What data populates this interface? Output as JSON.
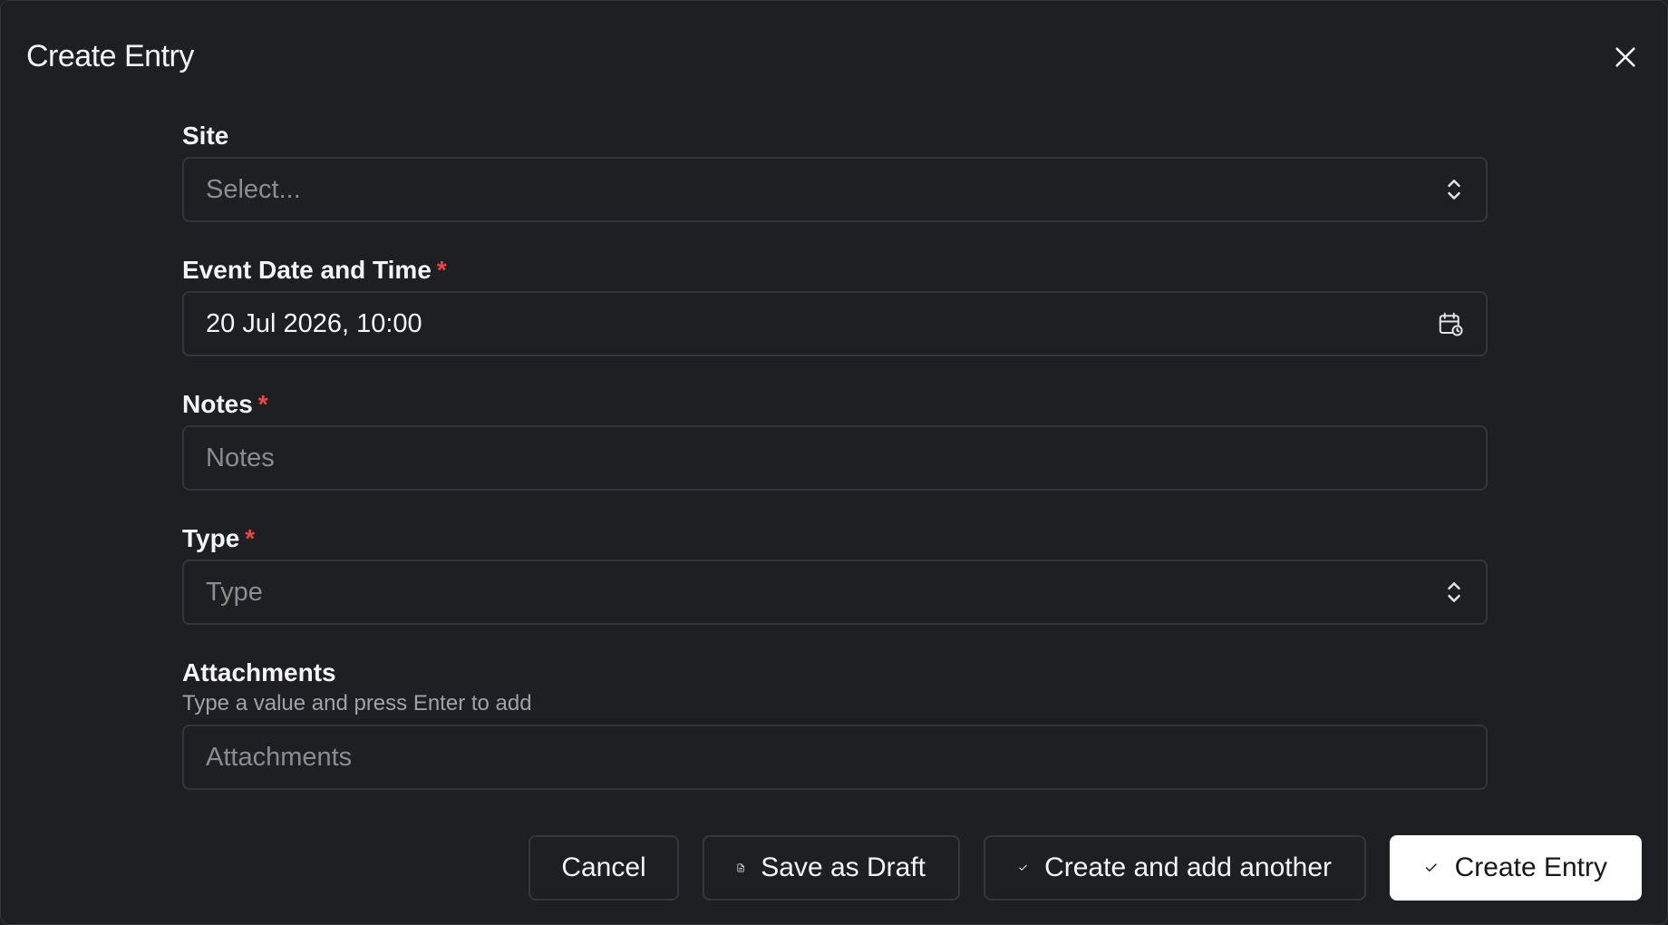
{
  "dialog": {
    "title": "Create Entry",
    "close_icon": "close-icon"
  },
  "fields": {
    "site": {
      "label": "Site",
      "placeholder": "Select...",
      "icon": "chevron-up-down-icon"
    },
    "event_date": {
      "label": "Event Date and Time",
      "required_mark": "*",
      "value": "20 Jul 2026, 10:00",
      "icon": "calendar-clock-icon"
    },
    "notes": {
      "label": "Notes",
      "required_mark": "*",
      "placeholder": "Notes"
    },
    "type": {
      "label": "Type",
      "required_mark": "*",
      "placeholder": "Type",
      "icon": "chevron-up-down-icon"
    },
    "attachments": {
      "label": "Attachments",
      "hint": "Type a value and press Enter to add",
      "placeholder": "Attachments"
    }
  },
  "footer": {
    "cancel_label": "Cancel",
    "save_draft_label": "Save as Draft",
    "save_draft_icon": "document-icon",
    "create_another_label": "Create and add another",
    "create_another_icon": "check-icon",
    "create_label": "Create Entry",
    "create_icon": "check-icon"
  },
  "colors": {
    "background": "#1e1f22",
    "border": "#33353a",
    "required": "#ef4444",
    "primary_button": "#ffffff"
  }
}
